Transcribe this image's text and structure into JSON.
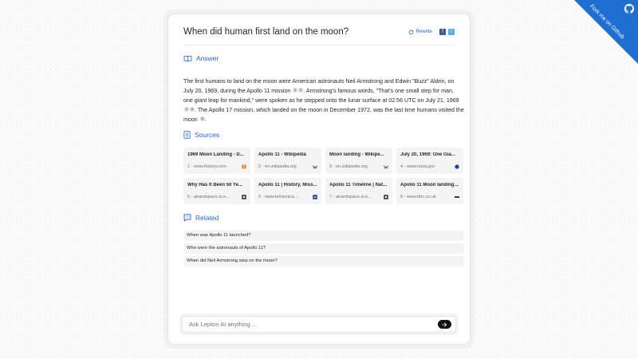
{
  "ribbon": {
    "label": "Fork me on Github"
  },
  "header": {
    "title": "When did human first land on the moon?",
    "rewrite_label": "Rewrite",
    "share_facebook": "f",
    "share_twitter": "t"
  },
  "answer": {
    "heading": "Answer",
    "segments": [
      "The first humans to land on the moon were American astronauts Neil Armstrong and Edwin \"Buzz\" Aldrin, on July 20, 1969, during the Apollo 11 mission",
      ". Armstrong's famous words, \"That's one small step for man, one giant leap for mankind,\" were spoken as he stepped onto the lunar surface at 02:56 UTC on July 21, 1969",
      ". The Apollo 17 mission, which landed on the moon in December 1972, was the last time humans visited the moon",
      "."
    ],
    "citations": [
      "1",
      "2",
      "7",
      "8",
      "6"
    ]
  },
  "sources": {
    "heading": "Sources",
    "items": [
      {
        "title": "1969 Moon Landing - D...",
        "meta": "1 - www.history.com",
        "icon": "history-favicon"
      },
      {
        "title": "Apollo 11 - Wikipedia",
        "meta": "2 - en.wikipedia.org",
        "icon": "wikipedia-favicon"
      },
      {
        "title": "Moon landing - Wikipe...",
        "meta": "3 - en.wikipedia.org",
        "icon": "wikipedia-favicon"
      },
      {
        "title": "July 20, 1969: One Gia...",
        "meta": "4 - www.nasa.gov",
        "icon": "nasa-favicon"
      },
      {
        "title": "Why Has It Been 50 Ye...",
        "meta": "5 - airandspace.si.e...",
        "icon": "smithsonian-favicon"
      },
      {
        "title": "Apollo 11 | History, Miss...",
        "meta": "6 - www.britannica....",
        "icon": "britannica-favicon"
      },
      {
        "title": "Apollo 11 Timeline | Nat...",
        "meta": "7 - airandspace.si.e...",
        "icon": "smithsonian-favicon"
      },
      {
        "title": "Apollo 11 Moon landing:...",
        "meta": "8 - www.bbc.co.uk",
        "icon": "bbc-favicon"
      }
    ]
  },
  "related": {
    "heading": "Related",
    "items": [
      "When was Apollo 11 launched?",
      "Who were the astronauts of Apollo 11?",
      "When did Neil Armstrong step on the moon?"
    ]
  },
  "ask": {
    "placeholder": "Ask Lepton AI anything ..."
  },
  "colors": {
    "accent": "#2563eb",
    "ribbon": "#1e6fd1",
    "card_bg": "#ffffff",
    "chip_bg": "#f4f4f5"
  }
}
